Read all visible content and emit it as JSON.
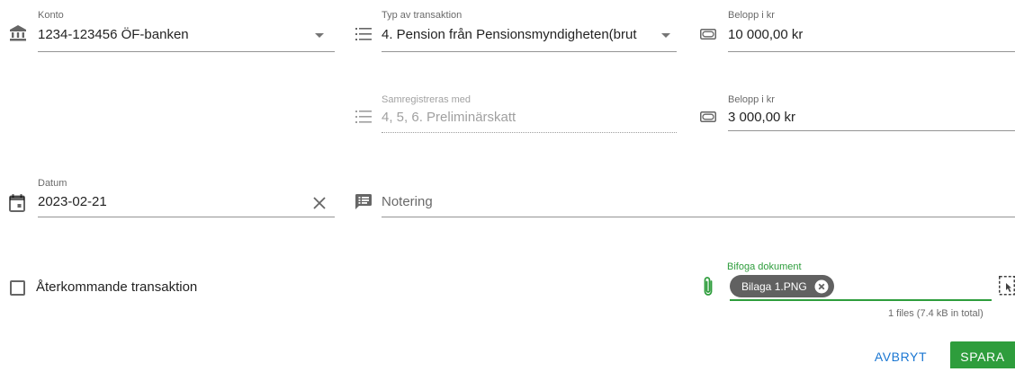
{
  "account": {
    "label": "Konto",
    "value": "1234-123456 ÖF-banken",
    "icon": "bank-icon"
  },
  "transaction_type": {
    "label": "Typ av transaktion",
    "value": "4. Pension från Pensionsmyndigheten(brut",
    "icon": "list-icon"
  },
  "amount_primary": {
    "label": "Belopp i kr",
    "value": "10 000,00 kr",
    "icon": "cash-icon"
  },
  "co_registered": {
    "label": "Samregistreras med",
    "value": "4, 5, 6. Preliminärskatt",
    "icon": "list-icon"
  },
  "amount_secondary": {
    "label": "Belopp i kr",
    "value": "3 000,00 kr",
    "icon": "cash-icon"
  },
  "date": {
    "label": "Datum",
    "value": "2023-02-21",
    "icon": "calendar-icon",
    "clear_icon": "close-icon"
  },
  "note": {
    "placeholder": "Notering",
    "icon": "note-icon"
  },
  "recurring": {
    "label": "Återkommande transaktion",
    "checked": false
  },
  "attachment": {
    "label": "Bifoga dokument",
    "file_chip": "Bilaga 1.PNG",
    "summary": "1 files (7.4 kB in total)",
    "icon": "paperclip-icon"
  },
  "actions": {
    "cancel": "AVBRYT",
    "save": "SPARA"
  },
  "colors": {
    "accent": "#1976d2",
    "primary_green": "#2e9d3c",
    "chip_bg": "#616161"
  }
}
